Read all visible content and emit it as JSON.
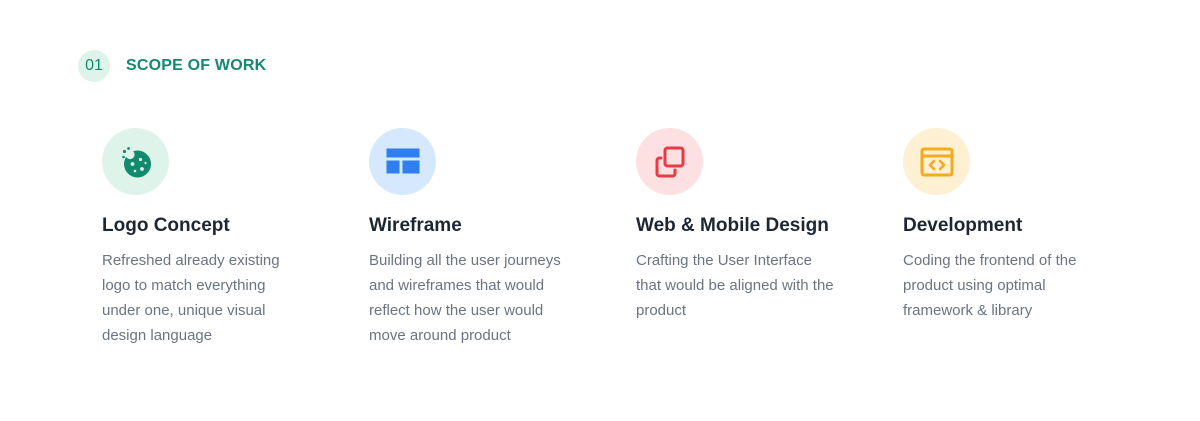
{
  "section": {
    "number": "01",
    "title": "SCOPE OF WORK"
  },
  "colors": {
    "accent": "#138a6b",
    "title_text": "#1d2733",
    "body_text": "#6b7480"
  },
  "cards": [
    {
      "title": "Logo Concept",
      "description": "Refreshed already existing logo to match everything under one, unique visual design language",
      "icon": "cookie-icon",
      "icon_bg": "#def4ea",
      "icon_color": "#138a6b"
    },
    {
      "title": "Wireframe",
      "description": "Building all the user journeys and wireframes that would reflect how the user would move around product",
      "icon": "layout-icon",
      "icon_bg": "#d6e8fc",
      "icon_color": "#2f7fef"
    },
    {
      "title": "Web & Mobile Design",
      "description": "Crafting the User Interface that would be aligned with the product",
      "icon": "copy-icon",
      "icon_bg": "#fde0e2",
      "icon_color": "#ea3a44"
    },
    {
      "title": "Development",
      "description": "Coding the frontend of the product using optimal framework & library",
      "icon": "code-window-icon",
      "icon_bg": "#fdf0d3",
      "icon_color": "#f5ab1d"
    }
  ]
}
